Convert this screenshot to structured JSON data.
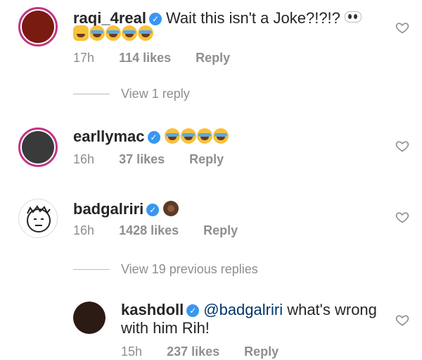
{
  "comments": [
    {
      "username": "raqi_4real",
      "text": "Wait this isn't a Joke?!?!?",
      "time": "17h",
      "likes": "114 likes",
      "reply_label": "Reply",
      "verified": true,
      "avatar_color": "#7a1b12"
    },
    {
      "username": "earllymac",
      "text": "",
      "time": "16h",
      "likes": "37 likes",
      "reply_label": "Reply",
      "verified": true,
      "avatar_color": "#3a3a3a"
    },
    {
      "username": "badgalriri",
      "text": "",
      "time": "16h",
      "likes": "1428 likes",
      "reply_label": "Reply",
      "verified": true,
      "avatar_color": "#ffffff"
    },
    {
      "username": "kashdoll",
      "mention": "@badgalriri",
      "text_line1": "what's wrong",
      "text_line2": "with him Rih!",
      "time": "15h",
      "likes": "237 likes",
      "reply_label": "Reply",
      "verified": true,
      "avatar_color": "#2c1a14"
    }
  ],
  "view_replies_1": "View 1 reply",
  "view_replies_2": "View 19 previous replies",
  "icons": {
    "verified": "verified-badge-icon",
    "heart": "heart-outline-icon",
    "emoji_laugh": "face-with-tears-of-joy-icon",
    "emoji_cat": "weary-cat-icon",
    "emoji_eyes": "eyes-icon",
    "emoji_facepalm": "woman-facepalming-icon"
  },
  "colors": {
    "verified": "#3897f0",
    "muted_text": "#8e8e8e",
    "mention": "#003569",
    "story_ring": "#c13584"
  }
}
